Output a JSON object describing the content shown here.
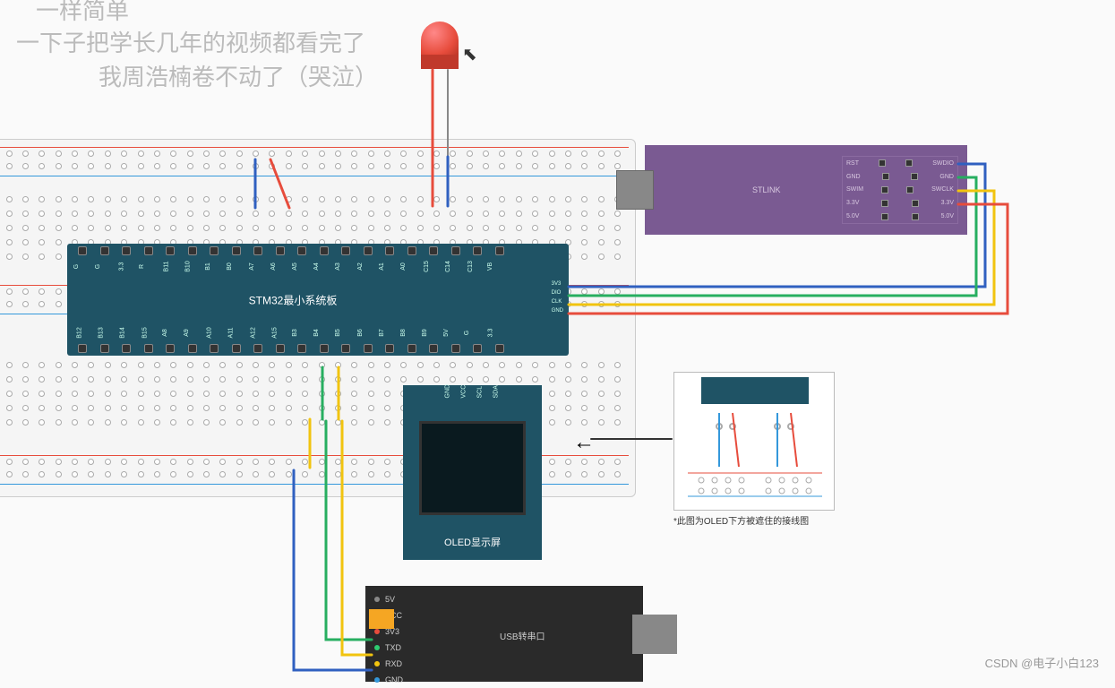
{
  "overlay": {
    "line1": "一样简单",
    "line2": "一下子把学长几年的视频都看完了",
    "line3": "我周浩楠卷不动了（哭泣）"
  },
  "components": {
    "stm32": {
      "title": "STM32最小系统板",
      "top_pins": [
        "G",
        "G",
        "3.3",
        "R",
        "B11",
        "B10",
        "B1",
        "B0",
        "A7",
        "A6",
        "A5",
        "A4",
        "A3",
        "A2",
        "A1",
        "A0",
        "C15",
        "C14",
        "C13",
        "VB"
      ],
      "bot_pins": [
        "B12",
        "B13",
        "B14",
        "B15",
        "A8",
        "A9",
        "A10",
        "A11",
        "A12",
        "A15",
        "B3",
        "B4",
        "B5",
        "B6",
        "B7",
        "B8",
        "B9",
        "5V",
        "G",
        "3.3"
      ],
      "swd": [
        "3V3",
        "DIO",
        "CLK",
        "GND"
      ]
    },
    "oled": {
      "title": "OLED显示屏",
      "pins": [
        "GND",
        "VCC",
        "SCL",
        "SDA"
      ]
    },
    "stlink": {
      "title": "STLINK",
      "rows": [
        {
          "left": "RST",
          "right": "SWDIO"
        },
        {
          "left": "GND",
          "right": "GND"
        },
        {
          "left": "SWIM",
          "right": "SWCLK"
        },
        {
          "left": "3.3V",
          "right": "3.3V"
        },
        {
          "left": "5.0V",
          "right": "5.0V"
        }
      ]
    },
    "usbserial": {
      "title": "USB转串口",
      "pins": [
        {
          "label": "5V",
          "color": "#888"
        },
        {
          "label": "VCC",
          "color": "#e74c3c"
        },
        {
          "label": "3V3",
          "color": "#e74c3c"
        },
        {
          "label": "TXD",
          "color": "#2ecc71"
        },
        {
          "label": "RXD",
          "color": "#f1c40f"
        },
        {
          "label": "GND",
          "color": "#3498db"
        }
      ]
    },
    "led": {
      "name": "LED"
    },
    "oled_detail_caption": "*此图为OLED下方被遮住的接线图"
  },
  "watermark": "CSDN @电子小白123",
  "chart_data": {
    "type": "wiring-diagram",
    "connections": [
      {
        "from": "STM32.SWD.3V3",
        "to": "STLINK.3.3V",
        "color": "red"
      },
      {
        "from": "STM32.SWD.DIO",
        "to": "STLINK.SWDIO",
        "color": "blue"
      },
      {
        "from": "STM32.SWD.CLK",
        "to": "STLINK.SWCLK",
        "color": "yellow"
      },
      {
        "from": "STM32.SWD.GND",
        "to": "STLINK.GND",
        "color": "green"
      },
      {
        "from": "STM32.A9(TX)",
        "to": "USBSerial.RXD",
        "color": "yellow"
      },
      {
        "from": "STM32.A10(RX)",
        "to": "USBSerial.TXD",
        "color": "green"
      },
      {
        "from": "Breadboard.GND",
        "to": "USBSerial.GND",
        "color": "blue"
      },
      {
        "from": "Breadboard.VCC",
        "to": "USBSerial.VCC",
        "color": "red",
        "via": "jumper"
      },
      {
        "from": "LED.anode",
        "to": "Breadboard.row",
        "color": "red"
      },
      {
        "from": "LED.cathode",
        "to": "Breadboard.row",
        "color": "blue"
      },
      {
        "from": "Breadboard.jumper1",
        "to": "Breadboard.rail",
        "color": "blue"
      },
      {
        "from": "Breadboard.jumper2",
        "to": "Breadboard.rail",
        "color": "red"
      }
    ]
  }
}
